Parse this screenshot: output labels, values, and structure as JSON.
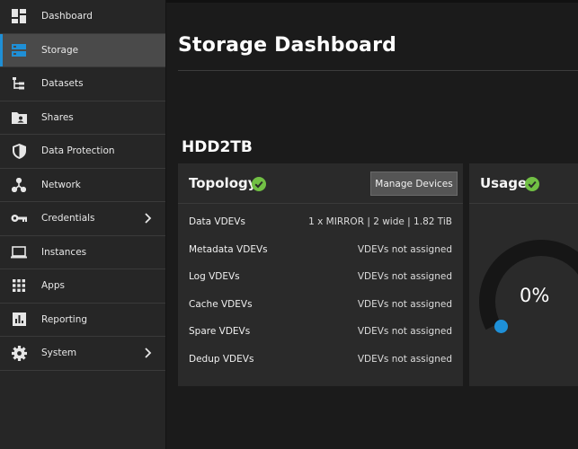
{
  "sidebar": {
    "items": [
      {
        "label": "Dashboard",
        "icon": "dashboard-icon",
        "active": false,
        "chevron": false
      },
      {
        "label": "Storage",
        "icon": "storage-icon",
        "active": true,
        "chevron": false
      },
      {
        "label": "Datasets",
        "icon": "datasets-icon",
        "active": false,
        "chevron": false
      },
      {
        "label": "Shares",
        "icon": "shares-icon",
        "active": false,
        "chevron": false
      },
      {
        "label": "Data Protection",
        "icon": "shield-icon",
        "active": false,
        "chevron": false
      },
      {
        "label": "Network",
        "icon": "network-icon",
        "active": false,
        "chevron": false
      },
      {
        "label": "Credentials",
        "icon": "key-icon",
        "active": false,
        "chevron": true
      },
      {
        "label": "Instances",
        "icon": "laptop-icon",
        "active": false,
        "chevron": false
      },
      {
        "label": "Apps",
        "icon": "apps-grid-icon",
        "active": false,
        "chevron": false
      },
      {
        "label": "Reporting",
        "icon": "reporting-icon",
        "active": false,
        "chevron": false
      },
      {
        "label": "System",
        "icon": "gear-icon",
        "active": false,
        "chevron": true
      }
    ]
  },
  "main": {
    "title": "Storage Dashboard",
    "pool_name": "HDD2TB"
  },
  "topology": {
    "title": "Topology",
    "status": "healthy",
    "manage_button": "Manage Devices",
    "rows": [
      {
        "label": "Data VDEVs",
        "value": "1 x MIRROR | 2 wide | 1.82 TiB"
      },
      {
        "label": "Metadata VDEVs",
        "value": "VDEVs not assigned"
      },
      {
        "label": "Log VDEVs",
        "value": "VDEVs not assigned"
      },
      {
        "label": "Cache VDEVs",
        "value": "VDEVs not assigned"
      },
      {
        "label": "Spare VDEVs",
        "value": "VDEVs not assigned"
      },
      {
        "label": "Dedup VDEVs",
        "value": "VDEVs not assigned"
      }
    ]
  },
  "usage": {
    "title": "Usage",
    "status": "healthy",
    "percent_text": "0%",
    "percent": 0
  },
  "colors": {
    "accent": "#1f8fd6",
    "ok": "#71bf44",
    "gauge_track": "#161616",
    "gauge_marker": "#1e90d8"
  }
}
